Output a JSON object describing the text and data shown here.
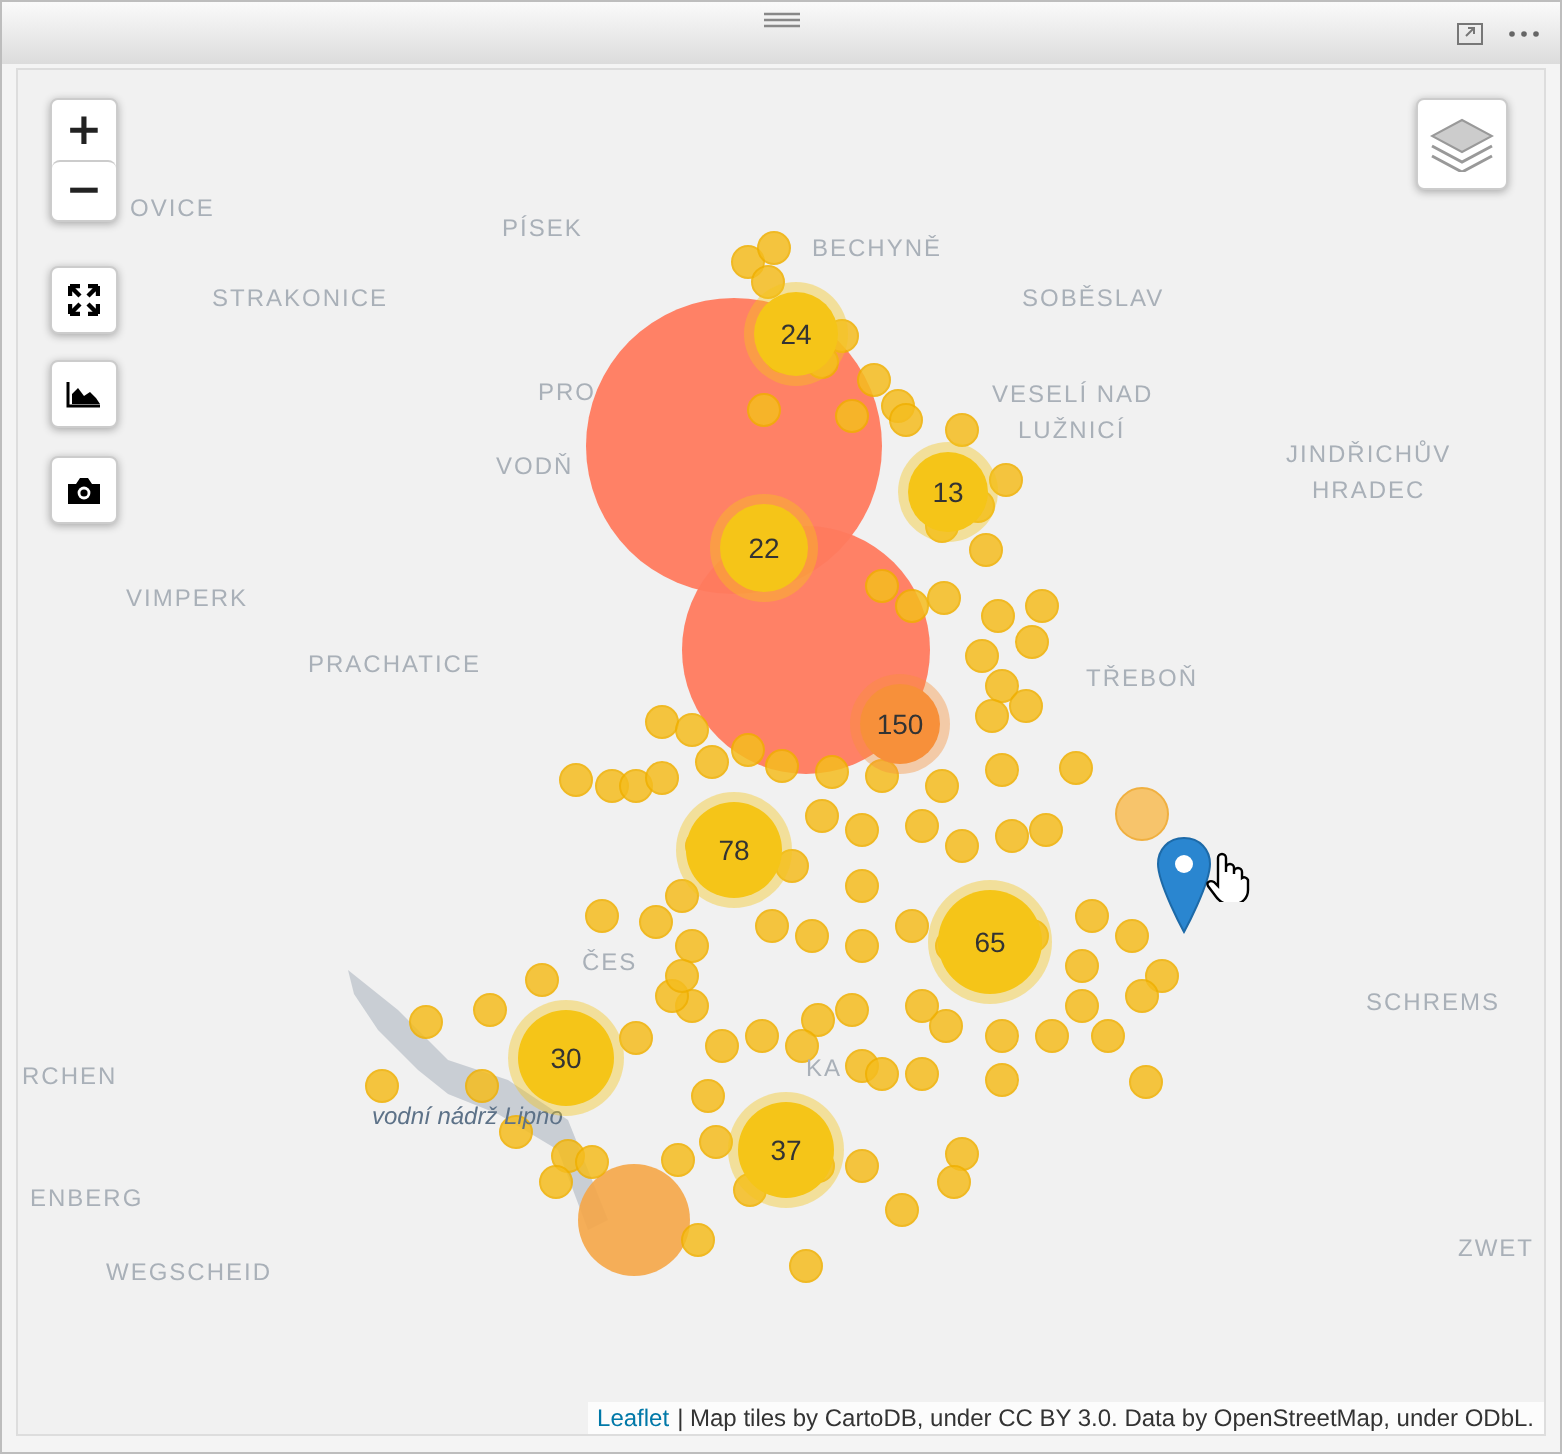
{
  "map": {
    "zoom_controls": [
      {
        "label": "+"
      },
      {
        "label": "−"
      }
    ],
    "place_labels": [
      {
        "text": "OVICE",
        "kind": "town"
      },
      {
        "text": "PÍSEK",
        "kind": "town"
      },
      {
        "text": "BECHYNĚ",
        "kind": "town"
      },
      {
        "text": "STRAKONICE",
        "kind": "town"
      },
      {
        "text": "SOBĚSLAV",
        "kind": "town"
      },
      {
        "text": "PRO",
        "kind": "town"
      },
      {
        "text": "VODŇ",
        "kind": "town"
      },
      {
        "text": "VESELÍ NAD",
        "kind": "town"
      },
      {
        "text": "LUŽNICÍ",
        "kind": "town"
      },
      {
        "text": "JINDŘICHŮV",
        "kind": "town"
      },
      {
        "text": "HRADEC",
        "kind": "town"
      },
      {
        "text": "VIMPERK",
        "kind": "town"
      },
      {
        "text": "PRACHATICE",
        "kind": "town"
      },
      {
        "text": "TŘEBOŇ",
        "kind": "town"
      },
      {
        "text": "ČES",
        "kind": "town"
      },
      {
        "text": "SCHREMS",
        "kind": "town"
      },
      {
        "text": "KA",
        "kind": "town"
      },
      {
        "text": "RCHEN",
        "kind": "town"
      },
      {
        "text": "ENBERG",
        "kind": "town"
      },
      {
        "text": "WEGSCHEID",
        "kind": "town"
      },
      {
        "text": "ZWET",
        "kind": "town"
      },
      {
        "text": "vodní nádrž Lipno",
        "kind": "water"
      }
    ],
    "clusters": [
      {
        "count": "24",
        "color": "#f5c518"
      },
      {
        "count": "13",
        "color": "#f5c518"
      },
      {
        "count": "22",
        "color": "#f5c518"
      },
      {
        "count": "150",
        "color": "#f7903a"
      },
      {
        "count": "78",
        "color": "#f5c518"
      },
      {
        "count": "65",
        "color": "#f5c518"
      },
      {
        "count": "30",
        "color": "#f5c518"
      },
      {
        "count": "37",
        "color": "#f5c518"
      }
    ],
    "attribution": {
      "link": "Leaflet",
      "text": "| Map tiles by CartoDB, under CC BY 3.0. Data by OpenStreetMap, under ODbL."
    }
  }
}
